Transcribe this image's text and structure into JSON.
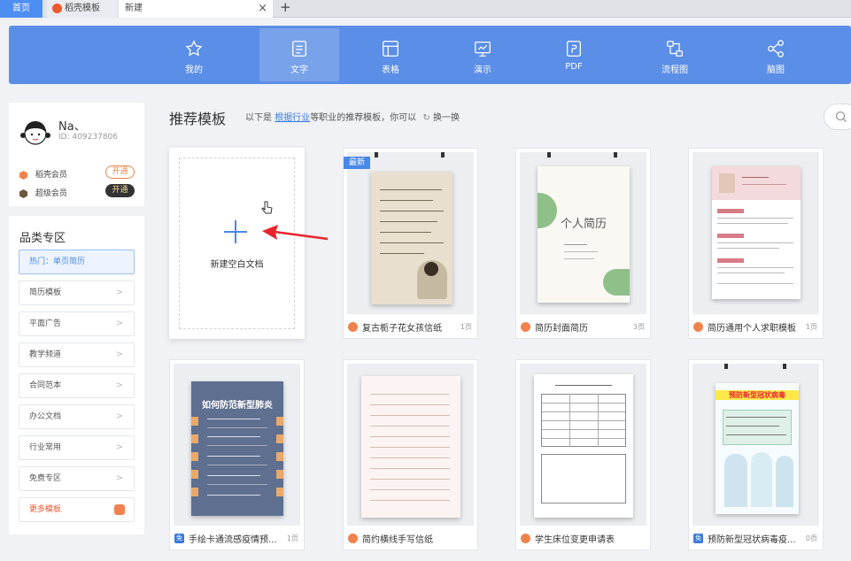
{
  "tabs": {
    "home": "首页",
    "daoke": "稻壳模板",
    "new": "新建",
    "close": "×",
    "add": "+"
  },
  "nav": [
    {
      "label": "我的",
      "icon": "star-icon"
    },
    {
      "label": "文字",
      "icon": "document-icon"
    },
    {
      "label": "表格",
      "icon": "table-icon"
    },
    {
      "label": "演示",
      "icon": "presentation-icon"
    },
    {
      "label": "PDF",
      "icon": "pdf-icon"
    },
    {
      "label": "流程图",
      "icon": "flowchart-icon"
    },
    {
      "label": "脑图",
      "icon": "mindmap-icon"
    }
  ],
  "profile": {
    "name": "Na、",
    "id": "ID: 409237806",
    "vip1": {
      "label": "稻壳会员",
      "button": "开通"
    },
    "vip2": {
      "label": "超级会员",
      "button": "开通"
    }
  },
  "categories": {
    "title": "品类专区",
    "items": [
      "热门：单页简历",
      "简历模板",
      "平面广告",
      "教学频道",
      "合同范本",
      "办公文档",
      "行业常用",
      "免费专区",
      "更多模板"
    ],
    "chevron": ">"
  },
  "main": {
    "title": "推荐模板",
    "subtitle_prefix": "以下是",
    "subtitle_link": "根据行业",
    "subtitle_suffix": "等职业的推荐模板，你可以",
    "refresh": "换一换",
    "new_doc": "新建空白文档",
    "new_badge": "最新"
  },
  "templates": [
    {
      "name": "复古栀子花女孩信纸",
      "pages": "1页",
      "badge": "daoke"
    },
    {
      "name": "简历封面简历",
      "pages": "3页",
      "badge": "daoke"
    },
    {
      "name": "简历通用个人求职模板",
      "pages": "1页",
      "badge": "daoke"
    },
    {
      "name": "手绘卡通流感疫情预...",
      "pages": "1页",
      "badge": "free",
      "badge_text": "免"
    },
    {
      "name": "简约横线手写信纸",
      "pages": "",
      "badge": "daoke"
    },
    {
      "name": "学生床位变更申请表",
      "pages": "",
      "badge": "daoke"
    },
    {
      "name": "预防新型冠状病毒疫...",
      "pages": "0页",
      "badge": "free",
      "badge_text": "免"
    }
  ],
  "thumb_text": {
    "resume_cover_title": "个人简历",
    "flu_title": "如何防范新型肺炎",
    "covid_title": "预防新型冠状病毒"
  },
  "colors": {
    "accent": "#5b8ee6",
    "orange": "#f0834d",
    "link": "#3a7bdc"
  }
}
